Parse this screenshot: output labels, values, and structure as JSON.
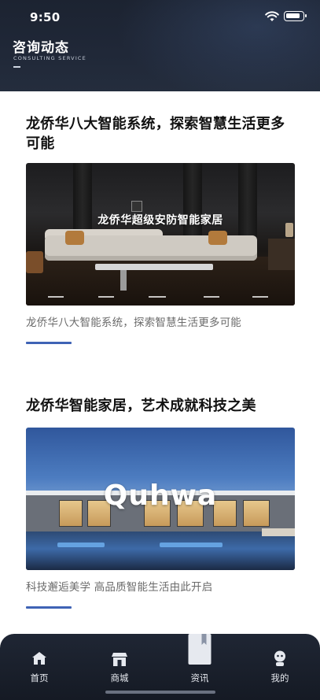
{
  "status_bar": {
    "time": "9:50"
  },
  "header": {
    "title": "咨询动态",
    "subtitle": "CONSULTING SERVICE"
  },
  "articles": [
    {
      "title": "龙侨华八大智能系统，探索智慧生活更多可能",
      "image_overlay_text": "龙侨华超级安防智能家居",
      "caption": "龙侨华八大智能系统，探索智慧生活更多可能"
    },
    {
      "title": "龙侨华智能家居，艺术成就科技之美",
      "image_overlay_text": "Quhwa",
      "caption": "科技邂逅美学  高品质智能生活由此开启"
    }
  ],
  "tabs": [
    {
      "label": "首页",
      "icon": "home-icon",
      "active": false
    },
    {
      "label": "商城",
      "icon": "store-icon",
      "active": false
    },
    {
      "label": "资讯",
      "icon": "news-icon",
      "active": true
    },
    {
      "label": "我的",
      "icon": "profile-icon",
      "active": false
    }
  ],
  "colors": {
    "accent": "#3f63b5",
    "header_bg": "#1c2331",
    "tabbar_bg": "#1f2634"
  }
}
